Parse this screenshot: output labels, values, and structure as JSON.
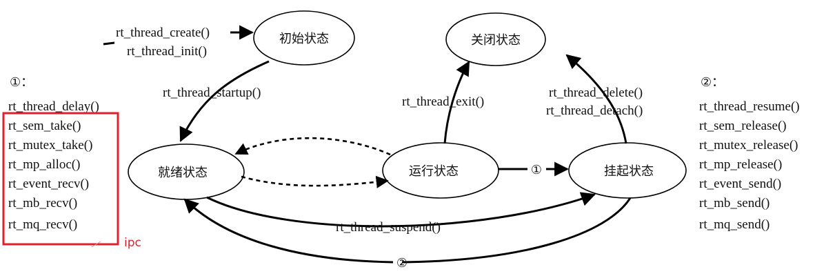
{
  "states": {
    "init": "初始状态",
    "closed": "关闭状态",
    "ready": "就绪状态",
    "running": "运行状态",
    "suspended": "挂起状态"
  },
  "transitions": {
    "create": "rt_thread_create()",
    "init": "rt_thread_init()",
    "startup": "rt_thread_startup()",
    "exit": "rt_thread_exit()",
    "delete": "rt_thread_delete()",
    "detach": "rt_thread_detach()",
    "suspend": "rt_thread_suspend()",
    "marker_1": "①",
    "marker_2": "②"
  },
  "left_list": {
    "header": "①：",
    "items": [
      "rt_thread_delay()",
      "rt_sem_take()",
      "rt_mutex_take()",
      "rt_mp_alloc()",
      "rt_event_recv()",
      "rt_mb_recv()",
      "rt_mq_recv()"
    ],
    "annotation": "ipc",
    "highlight_color": "#e0202a"
  },
  "right_list": {
    "header": "②：",
    "items": [
      "rt_thread_resume()",
      "rt_sem_release()",
      "rt_mutex_release()",
      "rt_mp_release()",
      "rt_event_send()",
      "rt_mb_send()",
      "rt_mq_send()"
    ]
  }
}
